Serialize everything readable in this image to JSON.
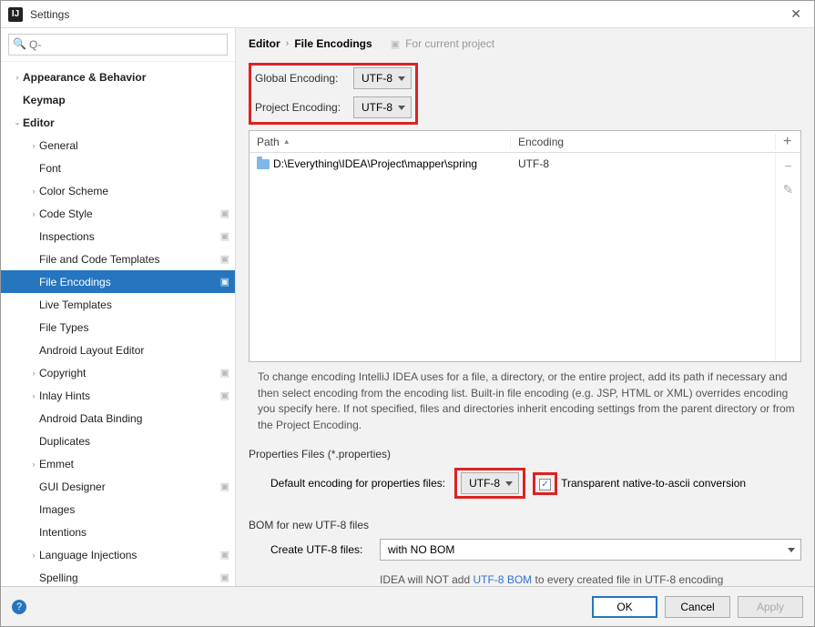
{
  "window": {
    "title": "Settings"
  },
  "search": {
    "placeholder": "Q-"
  },
  "sidebar": {
    "items": [
      {
        "label": "Appearance & Behavior",
        "depth": 0,
        "arrow": "›",
        "bold": true
      },
      {
        "label": "Keymap",
        "depth": 0,
        "arrow": "",
        "bold": true
      },
      {
        "label": "Editor",
        "depth": 0,
        "arrow": "⌄",
        "bold": true
      },
      {
        "label": "General",
        "depth": 1,
        "arrow": "›"
      },
      {
        "label": "Font",
        "depth": 1,
        "arrow": ""
      },
      {
        "label": "Color Scheme",
        "depth": 1,
        "arrow": "›"
      },
      {
        "label": "Code Style",
        "depth": 1,
        "arrow": "›",
        "proj": true
      },
      {
        "label": "Inspections",
        "depth": 1,
        "arrow": "",
        "proj": true
      },
      {
        "label": "File and Code Templates",
        "depth": 1,
        "arrow": "",
        "proj": true
      },
      {
        "label": "File Encodings",
        "depth": 1,
        "arrow": "",
        "proj": true,
        "selected": true
      },
      {
        "label": "Live Templates",
        "depth": 1,
        "arrow": ""
      },
      {
        "label": "File Types",
        "depth": 1,
        "arrow": ""
      },
      {
        "label": "Android Layout Editor",
        "depth": 1,
        "arrow": ""
      },
      {
        "label": "Copyright",
        "depth": 1,
        "arrow": "›",
        "proj": true
      },
      {
        "label": "Inlay Hints",
        "depth": 1,
        "arrow": "›",
        "proj": true
      },
      {
        "label": "Android Data Binding",
        "depth": 1,
        "arrow": ""
      },
      {
        "label": "Duplicates",
        "depth": 1,
        "arrow": ""
      },
      {
        "label": "Emmet",
        "depth": 1,
        "arrow": "›"
      },
      {
        "label": "GUI Designer",
        "depth": 1,
        "arrow": "",
        "proj": true
      },
      {
        "label": "Images",
        "depth": 1,
        "arrow": ""
      },
      {
        "label": "Intentions",
        "depth": 1,
        "arrow": ""
      },
      {
        "label": "Language Injections",
        "depth": 1,
        "arrow": "›",
        "proj": true
      },
      {
        "label": "Spelling",
        "depth": 1,
        "arrow": "",
        "proj": true
      }
    ]
  },
  "breadcrumb": {
    "a": "Editor",
    "b": "File Encodings",
    "note": "For current project"
  },
  "form": {
    "global_label": "Global Encoding:",
    "global_value": "UTF-8",
    "project_label": "Project Encoding:",
    "project_value": "UTF-8"
  },
  "table": {
    "col_path": "Path",
    "col_encoding": "Encoding",
    "rows": [
      {
        "path": "D:\\Everything\\IDEA\\Project\\mapper\\spring",
        "encoding": "UTF-8"
      }
    ]
  },
  "hint": "To change encoding IntelliJ IDEA uses for a file, a directory, or the entire project, add its path if necessary and then select encoding from the encoding list. Built-in file encoding (e.g. JSP, HTML or XML) overrides encoding you specify here. If not specified, files and directories inherit encoding settings from the parent directory or from the Project Encoding.",
  "properties": {
    "section": "Properties Files (*.properties)",
    "label": "Default encoding for properties files:",
    "value": "UTF-8",
    "checkbox_label": "Transparent native-to-ascii conversion"
  },
  "bom": {
    "section": "BOM for new UTF-8 files",
    "label": "Create UTF-8 files:",
    "value": "with NO BOM",
    "note_pre": "IDEA will NOT add ",
    "note_link": "UTF-8 BOM",
    "note_post": " to every created file in UTF-8 encoding"
  },
  "footer": {
    "ok": "OK",
    "cancel": "Cancel",
    "apply": "Apply"
  }
}
